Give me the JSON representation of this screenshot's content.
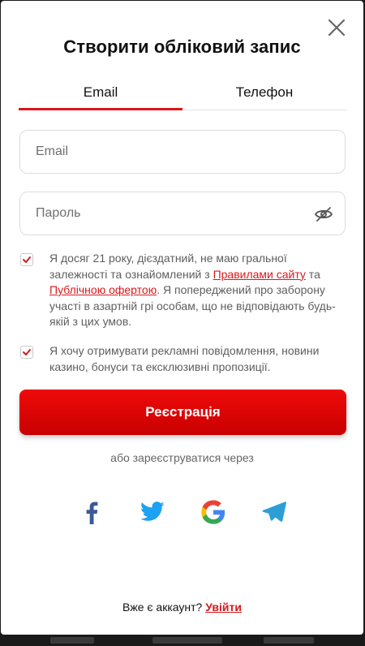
{
  "modal": {
    "title": "Створити обліковий запис",
    "close_icon": "close-icon"
  },
  "tabs": [
    {
      "label": "Email",
      "active": true
    },
    {
      "label": "Телефон",
      "active": false
    }
  ],
  "form": {
    "email_placeholder": "Email",
    "email_value": "",
    "password_placeholder": "Пароль",
    "password_value": "",
    "password_toggle_icon": "eye-off-icon"
  },
  "consent": {
    "age": {
      "checked": true,
      "text_before": "Я досяг 21 року, дієздатний, не маю гральної залежності та ознайомлений з ",
      "link_rules": "Правилами сайту",
      "text_and": " та ",
      "link_offer": "Публічною офертою",
      "text_after": ". Я попереджений про заборону участі в азартній грі особам, що не відповідають будь-якій з цих умов."
    },
    "marketing": {
      "checked": true,
      "text": "Я хочу отримувати рекламні повідомлення, новини казино, бонуси та ексклюзивні пропозиції."
    }
  },
  "register_button": "Реєстрація",
  "or_text": "або зареєструватися через",
  "social": [
    "facebook-icon",
    "twitter-icon",
    "google-icon",
    "telegram-icon"
  ],
  "footer": {
    "question": "Вже є аккаунт? ",
    "login_link": "Увійти"
  },
  "colors": {
    "accent": "#d7191c",
    "button": "#e60000",
    "facebook": "#3b5998",
    "twitter": "#1da1f2",
    "telegram": "#2e9fd6"
  }
}
